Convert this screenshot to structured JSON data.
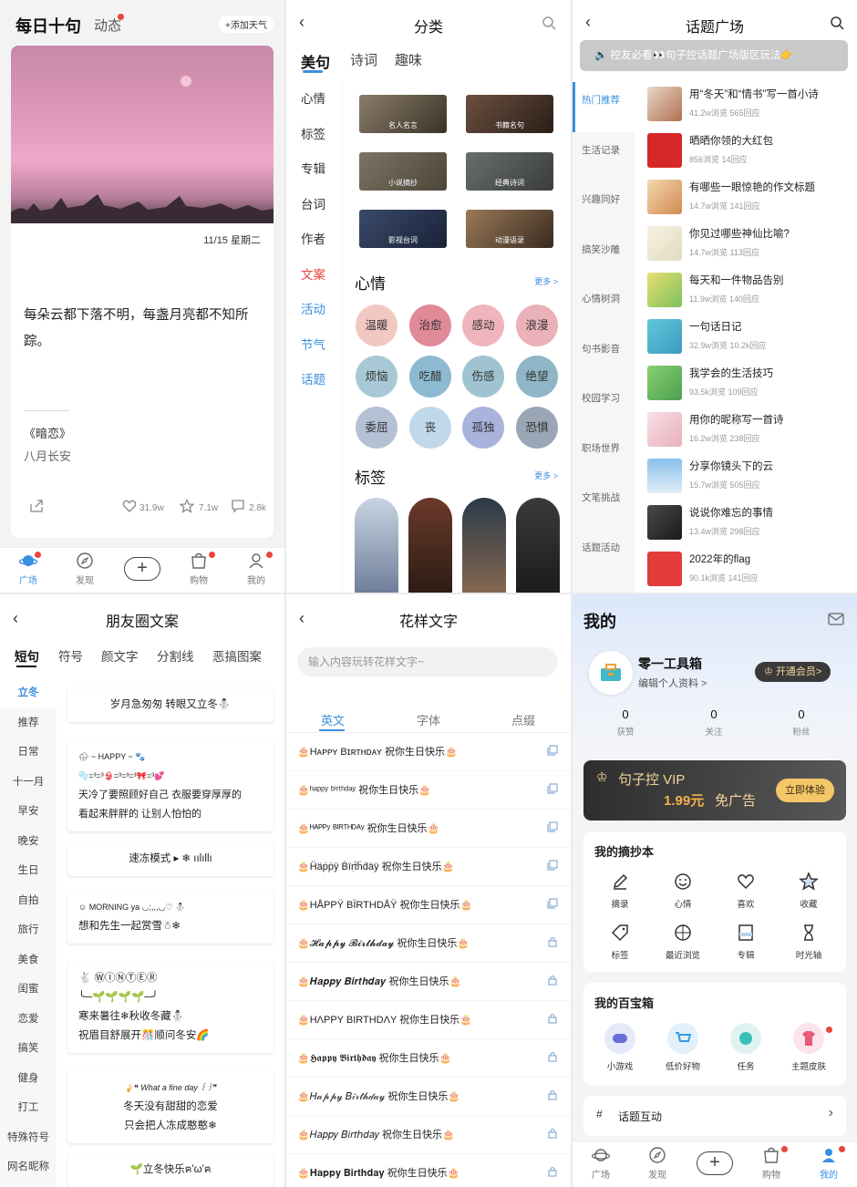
{
  "p1": {
    "title": "每日十句",
    "dynamic": "动态",
    "add_weather": "+添加天气",
    "date": "11/15 星期二",
    "quote": "每朵云都下落不明，每盏月亮都不知所踪。",
    "book": "《暗恋》",
    "author": "八月长安",
    "likes": "31.9w",
    "stars": "7.1w",
    "comments": "2.8k"
  },
  "tabs": [
    "广场",
    "发现",
    "购物",
    "我的"
  ],
  "p2": {
    "title": "分类",
    "tabs": [
      "美句",
      "诗词",
      "趣味"
    ],
    "side": [
      "心情",
      "标签",
      "专辑",
      "台词",
      "作者",
      "文案",
      "活动",
      "节气",
      "话题"
    ],
    "thumbs": [
      "名人名言",
      "书籍名句",
      "小说摘抄",
      "经典诗词",
      "影视台词",
      "动漫语录"
    ],
    "mood_title": "心情",
    "tag_title": "标签",
    "more": "更多 >",
    "moods": [
      "温暖",
      "治愈",
      "感动",
      "浪漫",
      "烦恼",
      "吃醋",
      "伤感",
      "绝望",
      "委屈",
      "丧",
      "孤独",
      "恐惧"
    ]
  },
  "p3": {
    "title": "话题广场",
    "banner": "控友必看👀句子控话题广场版区玩法👉",
    "side": [
      "热门推荐",
      "生活记录",
      "兴趣同好",
      "搞笑沙雕",
      "心情树洞",
      "句书影音",
      "校园学习",
      "职场世界",
      "文笔挑战",
      "话题活动"
    ],
    "topics": [
      {
        "t": "用“冬天”和“情书”写一首小诗",
        "s": "41.2w浏览  565回应"
      },
      {
        "t": "晒晒你领的大红包",
        "s": "856浏览  14回应"
      },
      {
        "t": "有哪些一眼惊艳的作文标题",
        "s": "14.7w浏览  141回应"
      },
      {
        "t": "你见过哪些神仙比喻?",
        "s": "14.7w浏览  113回应"
      },
      {
        "t": "每天和一件物品告别",
        "s": "11.9w浏览  140回应"
      },
      {
        "t": "一句话日记",
        "s": "32.9w浏览  10.2k回应"
      },
      {
        "t": "我学会的生活技巧",
        "s": "93.5k浏览  109回应"
      },
      {
        "t": "用你的昵称写一首诗",
        "s": "16.2w浏览  238回应"
      },
      {
        "t": "分享你镜头下的云",
        "s": "15.7w浏览  505回应"
      },
      {
        "t": "说说你难忘的事情",
        "s": "13.4w浏览  298回应"
      },
      {
        "t": "2022年的flag",
        "s": "90.1k浏览  141回应"
      }
    ]
  },
  "p4": {
    "title": "朋友圈文案",
    "tabs": [
      "短句",
      "符号",
      "颜文字",
      "分割线",
      "恶搞图案"
    ],
    "side": [
      "立冬",
      "推荐",
      "日常",
      "十一月",
      "早安",
      "晚安",
      "生日",
      "自拍",
      "旅行",
      "美食",
      "闺蜜",
      "恋爱",
      "搞笑",
      "健身",
      "打工",
      "特殊符号",
      "网名昵称"
    ],
    "cards": [
      [
        "岁月急匆匆 转眼又立冬⛄"
      ],
      [
        "🌧 ~ HAPPY ~ 🐾",
        "🫧=³=³👙=³=³=³🎀=³💕",
        "天冷了要照顾好自己 衣服要穿厚厚的",
        "看起来胖胖的 让别人怕怕的"
      ],
      [
        "速冻模式 ▸ ❄ ıılıllı"
      ],
      [
        "☺ MORNING ya ◡;,,,◡♡ ⛄",
        "想和先生一起赏雪☃❄"
      ],
      [
        "🐇 ⓌⒾⓃⓉⒺⓇ",
        "╰─🌱🌱🌱🌱─╯",
        "寒来暑往❄秋收冬藏⛄",
        "祝眉目舒展开🎊顺问冬安🌈"
      ],
      [
        "🍦❝ What a fine day ꒰꒱❞",
        "冬天没有甜甜的恋爱",
        "只会把人冻成憨憨❄"
      ],
      [
        "🌱立冬快乐ฅ'ω'ฅ"
      ]
    ]
  },
  "p5": {
    "title": "花样文字",
    "search_placeholder": "输入内容玩转花样文字~",
    "tabs": [
      "英文",
      "字体",
      "点缀"
    ],
    "rows": [
      "🎂Hᴀᴘᴘʏ Bɪʀᴛʜᴅᴀʏ 祝你生日快乐🎂",
      "🎂ʰᵃᵖᵖʸ ᵇⁱʳᵗʰᵈᵃʸ 祝你生日快乐🎂",
      "🎂ᴴᴬᴾᴾʸ ᴮᴵᴿᵀᴴᴰᴬʸ 祝你生日快乐🎂",
      "🎂Ḧäṗṗÿ Ḃïṛẗḧḋäÿ 祝你生日快乐🎂",
      "🎂HÅPPŸ BÏRTHDÅŸ 祝你生日快乐🎂",
      "🎂𝓗𝓪𝓹𝓹𝔂 𝓑𝓲𝓻𝓽𝓱𝓭𝓪𝔂 祝你生日快乐🎂",
      "🎂𝑯𝒂𝒑𝒑𝒚 𝑩𝒊𝒓𝒕𝒉𝒅𝒂𝒚 祝你生日快乐🎂",
      "🎂HΛPPY BIRTHDΛY 祝你生日快乐🎂",
      "🎂𝕳𝖆𝖕𝖕𝖞 𝕭𝖎𝖗𝖙𝖍𝖉𝖆𝖞 祝你生日快乐🎂",
      "🎂𝐻𝒶𝓅𝓅𝓎 𝐵𝒾𝓇𝓉𝒽𝒹𝒶𝓎 祝你生日快乐🎂",
      "🎂𝐻𝑎𝑝𝑝𝑦 𝐵𝑖𝑟𝑡ℎ𝑑𝑎𝑦 祝你生日快乐🎂",
      "🎂𝐇𝐚𝐩𝐩𝐲 𝐁𝐢𝐫𝐭𝐡𝐝𝐚𝐲 祝你生日快乐🎂"
    ]
  },
  "p6": {
    "title": "我的",
    "username": "零一工具箱",
    "edit": "编辑个人资料 >",
    "member_btn": "开通会员>",
    "stats": [
      {
        "v": "0",
        "l": "获赞"
      },
      {
        "v": "0",
        "l": "关注"
      },
      {
        "v": "0",
        "l": "粉丝"
      }
    ],
    "vip_title": "句子控 VIP",
    "vip_price": "1.99元",
    "vip_sub": "免广告",
    "vip_btn": "立即体验",
    "notebook_title": "我的摘抄本",
    "notebook": [
      "摘录",
      "心情",
      "喜欢",
      "收藏",
      "标签",
      "最近浏览",
      "专辑",
      "时光轴"
    ],
    "treasure_title": "我的百宝箱",
    "treasure": [
      "小游戏",
      "低价好物",
      "任务",
      "主题皮肤"
    ],
    "topic_interact": "话题互动"
  },
  "colors": {
    "accent": "#3b8fe0",
    "badge": "#e8453c"
  }
}
